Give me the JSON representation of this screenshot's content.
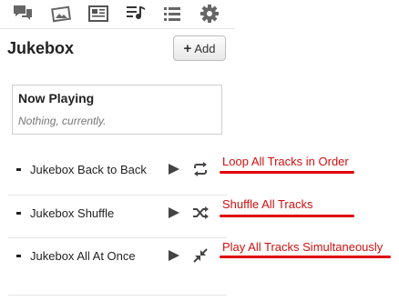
{
  "tabs": [
    {
      "icon": "chat-icon"
    },
    {
      "icon": "picture-icon"
    },
    {
      "icon": "newspaper-icon"
    },
    {
      "icon": "music-list-icon",
      "active": true
    },
    {
      "icon": "list-icon"
    },
    {
      "icon": "gear-icon"
    }
  ],
  "header": {
    "title": "Jukebox",
    "add_label": "Add"
  },
  "now_playing": {
    "title": "Now Playing",
    "status": "Nothing, currently."
  },
  "tracks": [
    {
      "name": "Jukebox Back to Back",
      "mode_icon": "repeat-icon",
      "annotation": "Loop All Tracks in Order"
    },
    {
      "name": "Jukebox Shuffle",
      "mode_icon": "shuffle-icon",
      "annotation": "Shuffle All Tracks"
    },
    {
      "name": "Jukebox All At Once",
      "mode_icon": "merge-arrows-icon",
      "annotation": "Play All Tracks Simultaneously"
    }
  ],
  "colors": {
    "annotation": "#d01010",
    "underline": "#e00000",
    "icon": "#555555"
  }
}
